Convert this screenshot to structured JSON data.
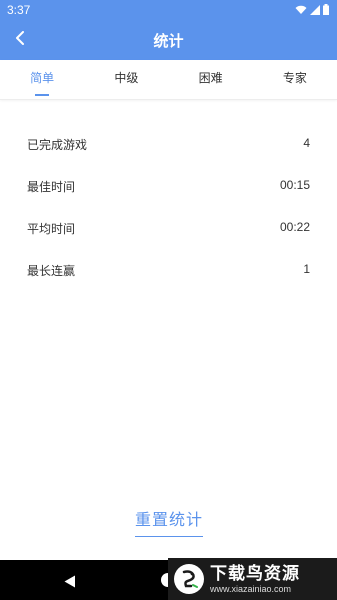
{
  "status_bar": {
    "time": "3:37"
  },
  "header": {
    "title": "统计"
  },
  "tabs": [
    {
      "label": "简单",
      "active": true
    },
    {
      "label": "中级",
      "active": false
    },
    {
      "label": "困难",
      "active": false
    },
    {
      "label": "专家",
      "active": false
    }
  ],
  "stats": [
    {
      "label": "已完成游戏",
      "value": "4"
    },
    {
      "label": "最佳时间",
      "value": "00:15"
    },
    {
      "label": "平均时间",
      "value": "00:22"
    },
    {
      "label": "最长连赢",
      "value": "1"
    }
  ],
  "reset_button": {
    "label": "重置统计"
  },
  "watermark": {
    "main": "下载鸟资源",
    "sub": "www.xiazainiao.com"
  },
  "colors": {
    "accent": "#5b93ec"
  }
}
